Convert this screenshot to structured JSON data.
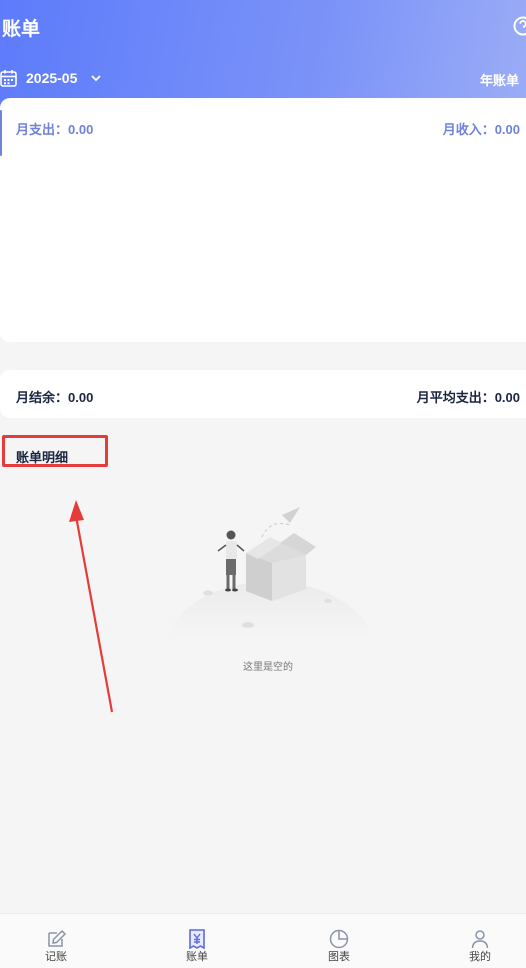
{
  "header": {
    "title": "账单",
    "date": "2025-05",
    "year_bill_label": "年账单"
  },
  "summary": {
    "expense_label": "月支出：0.00",
    "income_label": "月收入：0.00"
  },
  "balance": {
    "left_label": "月结余：0.00",
    "right_label": "月平均支出：0.00"
  },
  "detail": {
    "title": "账单明细",
    "empty_text": "这里是空的"
  },
  "nav": {
    "items": [
      {
        "label": "记账",
        "icon": "pencil-icon"
      },
      {
        "label": "账单",
        "icon": "bill-icon"
      },
      {
        "label": "图表",
        "icon": "chart-icon"
      },
      {
        "label": "我的",
        "icon": "user-icon"
      }
    ],
    "active_index": 1
  },
  "colors": {
    "header_gradient_start": "#5d7bfb",
    "header_gradient_end": "#9cadf6",
    "accent": "#6f83d8",
    "annotation_red": "#e53b3b"
  }
}
